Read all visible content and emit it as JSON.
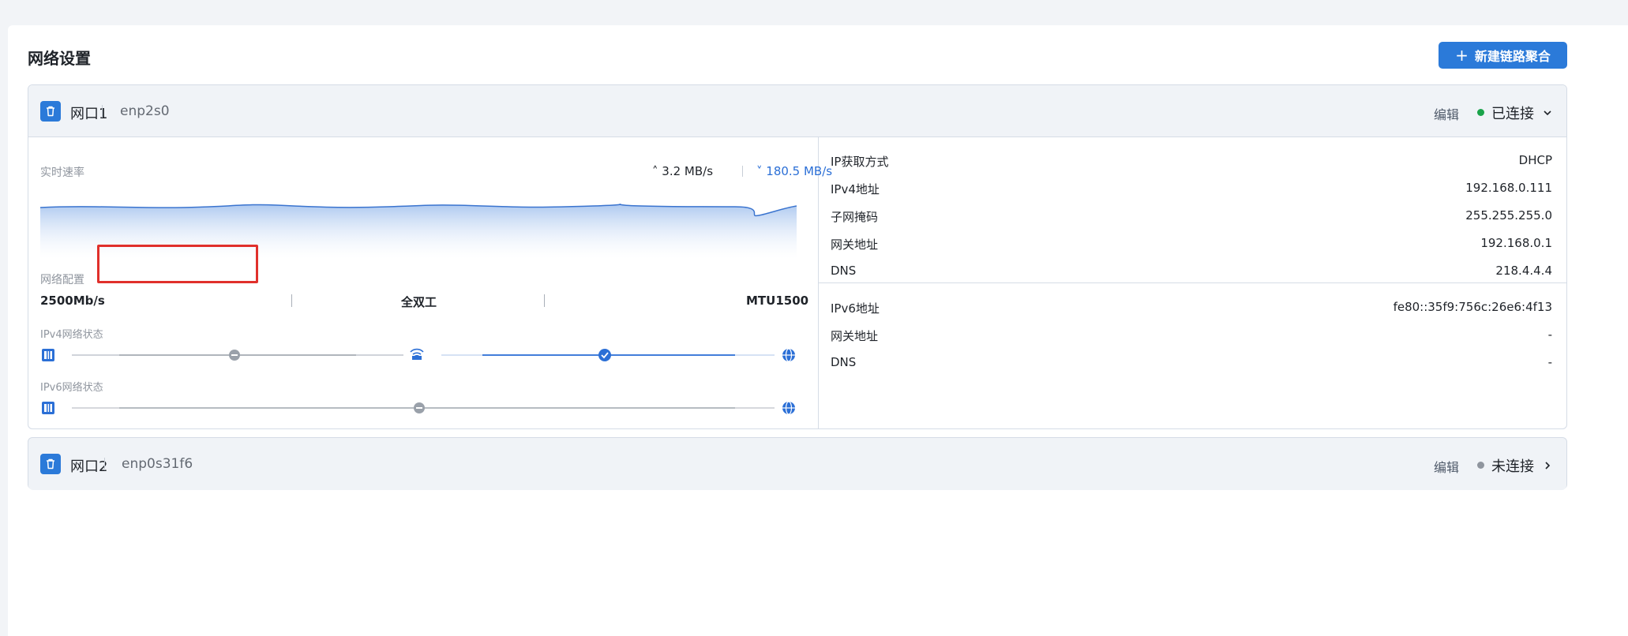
{
  "page": {
    "title": "网络设置",
    "new_bond_button": "新建链路聚合"
  },
  "ports": [
    {
      "name": "网口1",
      "interface": "enp2s0",
      "edit_label": "编辑",
      "status": "已连接",
      "status_color": "#1aa34a",
      "expanded": true,
      "realtime_label": "实时速率",
      "upload_speed": "3.2 MB/s",
      "download_speed": "180.5 MB/s",
      "config_label": "网络配置",
      "link_speed": "2500Mb/s",
      "duplex": "全双工",
      "mtu": "MTU1500",
      "ipv4_status_label": "IPv4网络状态",
      "ipv6_status_label": "IPv6网络状态",
      "ipv4_info": [
        {
          "label": "IP获取方式",
          "value": "DHCP"
        },
        {
          "label": "IPv4地址",
          "value": "192.168.0.111"
        },
        {
          "label": "子网掩码",
          "value": "255.255.255.0"
        },
        {
          "label": "网关地址",
          "value": "192.168.0.1"
        },
        {
          "label": "DNS",
          "value": "218.4.4.4"
        }
      ],
      "ipv6_info": [
        {
          "label": "IPv6地址",
          "value": "fe80::35f9:756c:26e6:4f13"
        },
        {
          "label": "网关地址",
          "value": "-"
        },
        {
          "label": "DNS",
          "value": "-"
        }
      ]
    },
    {
      "name": "网口2",
      "interface": "enp0s31f6",
      "edit_label": "编辑",
      "status": "未连接",
      "status_color": "#8f959e",
      "expanded": false
    }
  ],
  "colors": {
    "accent": "#2b7ad9",
    "highlight_box": "#e0302b"
  },
  "icons": [
    "trash-icon",
    "chevron-down-icon",
    "chevron-right-icon",
    "nic-icon",
    "router-icon",
    "globe-icon",
    "check-circle-icon",
    "minus-circle-icon",
    "arrow-up-icon",
    "arrow-down-icon",
    "plus-icon"
  ]
}
